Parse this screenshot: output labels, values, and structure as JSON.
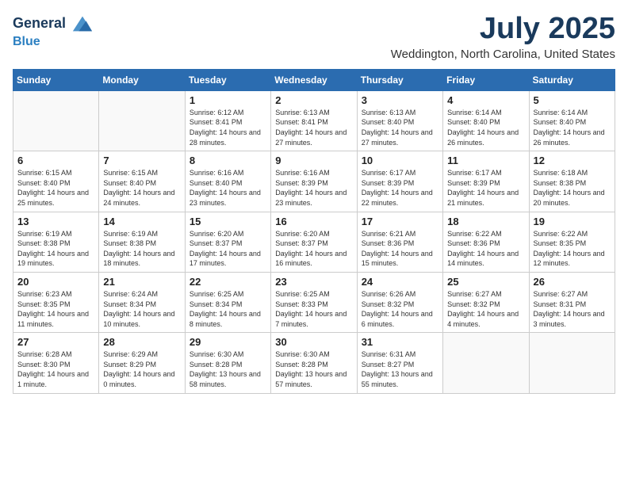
{
  "header": {
    "logo_line1": "General",
    "logo_line2": "Blue",
    "month_title": "July 2025",
    "location": "Weddington, North Carolina, United States"
  },
  "days_of_week": [
    "Sunday",
    "Monday",
    "Tuesday",
    "Wednesday",
    "Thursday",
    "Friday",
    "Saturday"
  ],
  "weeks": [
    [
      {
        "day": "",
        "info": ""
      },
      {
        "day": "",
        "info": ""
      },
      {
        "day": "1",
        "info": "Sunrise: 6:12 AM\nSunset: 8:41 PM\nDaylight: 14 hours and 28 minutes."
      },
      {
        "day": "2",
        "info": "Sunrise: 6:13 AM\nSunset: 8:41 PM\nDaylight: 14 hours and 27 minutes."
      },
      {
        "day": "3",
        "info": "Sunrise: 6:13 AM\nSunset: 8:40 PM\nDaylight: 14 hours and 27 minutes."
      },
      {
        "day": "4",
        "info": "Sunrise: 6:14 AM\nSunset: 8:40 PM\nDaylight: 14 hours and 26 minutes."
      },
      {
        "day": "5",
        "info": "Sunrise: 6:14 AM\nSunset: 8:40 PM\nDaylight: 14 hours and 26 minutes."
      }
    ],
    [
      {
        "day": "6",
        "info": "Sunrise: 6:15 AM\nSunset: 8:40 PM\nDaylight: 14 hours and 25 minutes."
      },
      {
        "day": "7",
        "info": "Sunrise: 6:15 AM\nSunset: 8:40 PM\nDaylight: 14 hours and 24 minutes."
      },
      {
        "day": "8",
        "info": "Sunrise: 6:16 AM\nSunset: 8:40 PM\nDaylight: 14 hours and 23 minutes."
      },
      {
        "day": "9",
        "info": "Sunrise: 6:16 AM\nSunset: 8:39 PM\nDaylight: 14 hours and 23 minutes."
      },
      {
        "day": "10",
        "info": "Sunrise: 6:17 AM\nSunset: 8:39 PM\nDaylight: 14 hours and 22 minutes."
      },
      {
        "day": "11",
        "info": "Sunrise: 6:17 AM\nSunset: 8:39 PM\nDaylight: 14 hours and 21 minutes."
      },
      {
        "day": "12",
        "info": "Sunrise: 6:18 AM\nSunset: 8:38 PM\nDaylight: 14 hours and 20 minutes."
      }
    ],
    [
      {
        "day": "13",
        "info": "Sunrise: 6:19 AM\nSunset: 8:38 PM\nDaylight: 14 hours and 19 minutes."
      },
      {
        "day": "14",
        "info": "Sunrise: 6:19 AM\nSunset: 8:38 PM\nDaylight: 14 hours and 18 minutes."
      },
      {
        "day": "15",
        "info": "Sunrise: 6:20 AM\nSunset: 8:37 PM\nDaylight: 14 hours and 17 minutes."
      },
      {
        "day": "16",
        "info": "Sunrise: 6:20 AM\nSunset: 8:37 PM\nDaylight: 14 hours and 16 minutes."
      },
      {
        "day": "17",
        "info": "Sunrise: 6:21 AM\nSunset: 8:36 PM\nDaylight: 14 hours and 15 minutes."
      },
      {
        "day": "18",
        "info": "Sunrise: 6:22 AM\nSunset: 8:36 PM\nDaylight: 14 hours and 14 minutes."
      },
      {
        "day": "19",
        "info": "Sunrise: 6:22 AM\nSunset: 8:35 PM\nDaylight: 14 hours and 12 minutes."
      }
    ],
    [
      {
        "day": "20",
        "info": "Sunrise: 6:23 AM\nSunset: 8:35 PM\nDaylight: 14 hours and 11 minutes."
      },
      {
        "day": "21",
        "info": "Sunrise: 6:24 AM\nSunset: 8:34 PM\nDaylight: 14 hours and 10 minutes."
      },
      {
        "day": "22",
        "info": "Sunrise: 6:25 AM\nSunset: 8:34 PM\nDaylight: 14 hours and 8 minutes."
      },
      {
        "day": "23",
        "info": "Sunrise: 6:25 AM\nSunset: 8:33 PM\nDaylight: 14 hours and 7 minutes."
      },
      {
        "day": "24",
        "info": "Sunrise: 6:26 AM\nSunset: 8:32 PM\nDaylight: 14 hours and 6 minutes."
      },
      {
        "day": "25",
        "info": "Sunrise: 6:27 AM\nSunset: 8:32 PM\nDaylight: 14 hours and 4 minutes."
      },
      {
        "day": "26",
        "info": "Sunrise: 6:27 AM\nSunset: 8:31 PM\nDaylight: 14 hours and 3 minutes."
      }
    ],
    [
      {
        "day": "27",
        "info": "Sunrise: 6:28 AM\nSunset: 8:30 PM\nDaylight: 14 hours and 1 minute."
      },
      {
        "day": "28",
        "info": "Sunrise: 6:29 AM\nSunset: 8:29 PM\nDaylight: 14 hours and 0 minutes."
      },
      {
        "day": "29",
        "info": "Sunrise: 6:30 AM\nSunset: 8:28 PM\nDaylight: 13 hours and 58 minutes."
      },
      {
        "day": "30",
        "info": "Sunrise: 6:30 AM\nSunset: 8:28 PM\nDaylight: 13 hours and 57 minutes."
      },
      {
        "day": "31",
        "info": "Sunrise: 6:31 AM\nSunset: 8:27 PM\nDaylight: 13 hours and 55 minutes."
      },
      {
        "day": "",
        "info": ""
      },
      {
        "day": "",
        "info": ""
      }
    ]
  ]
}
